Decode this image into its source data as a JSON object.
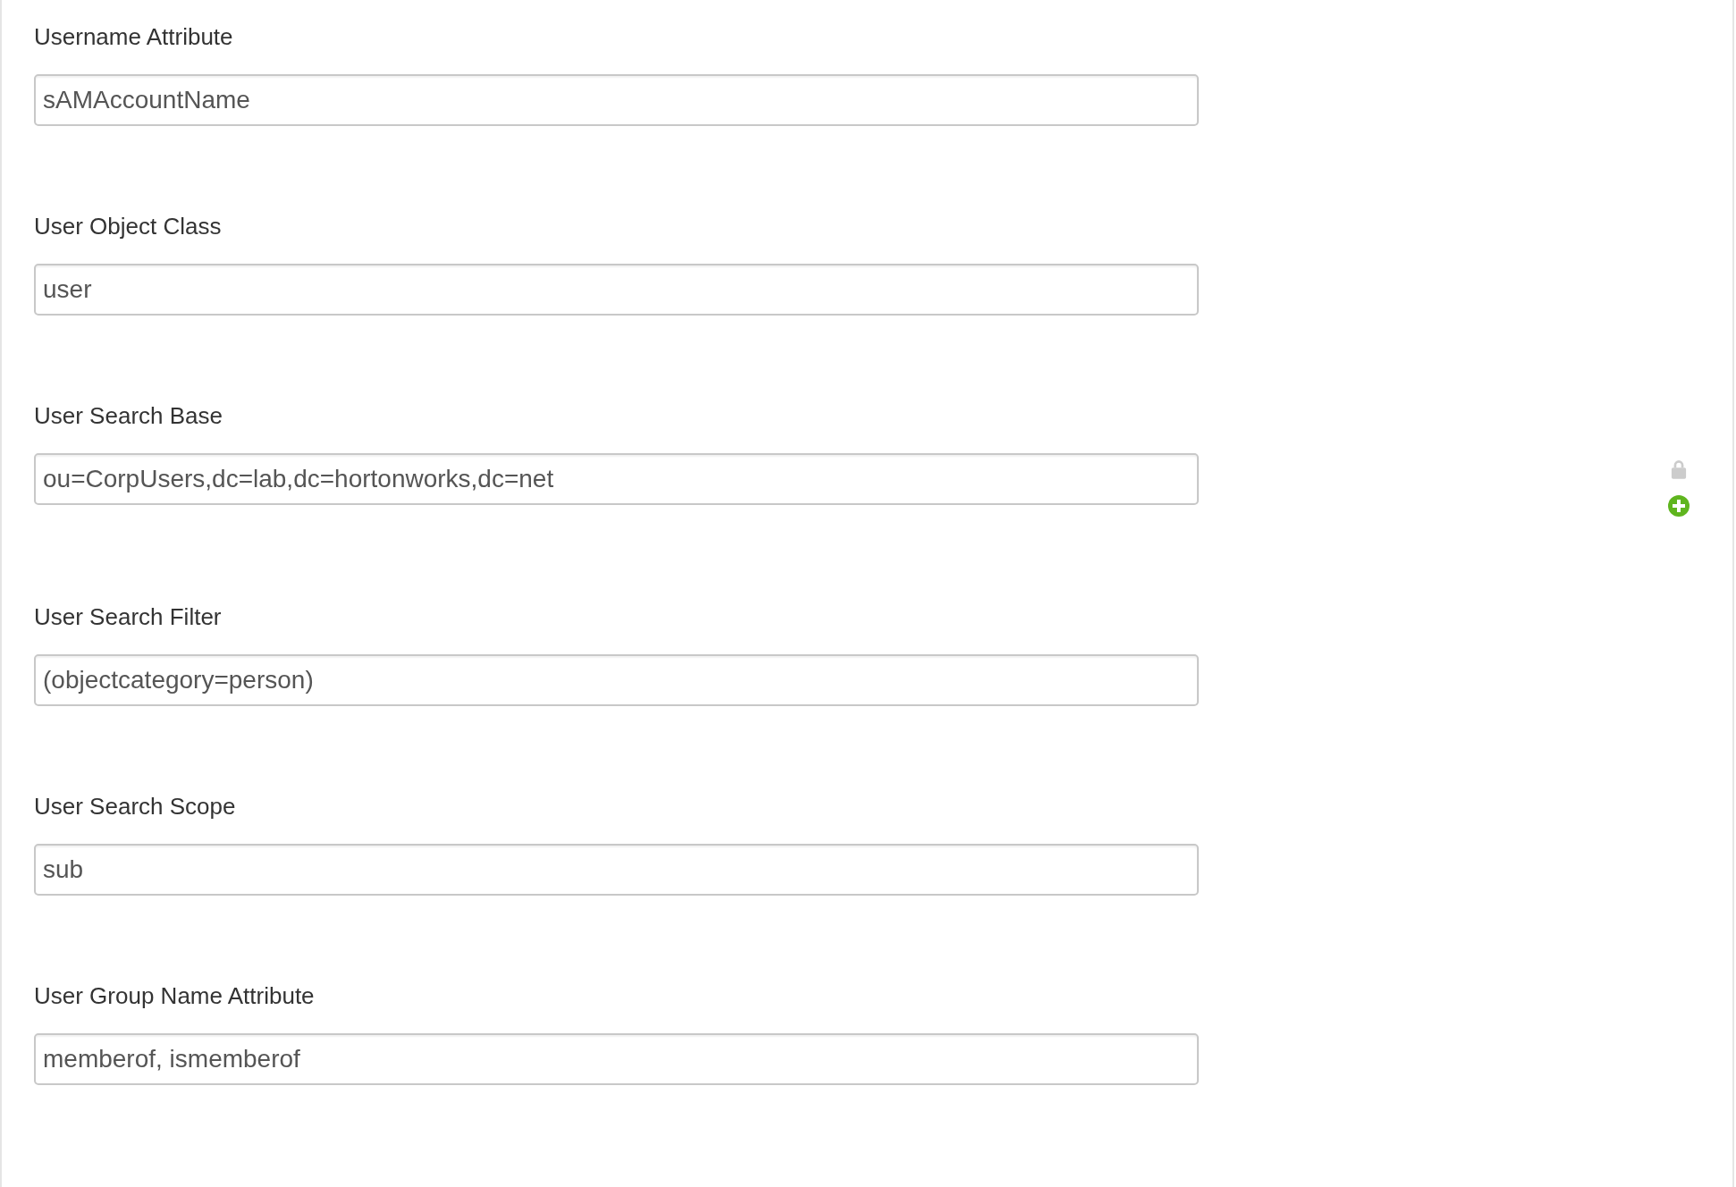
{
  "fields": [
    {
      "label": "Username Attribute",
      "value": "sAMAccountName",
      "hovered": false
    },
    {
      "label": "User Object Class",
      "value": "user",
      "hovered": false
    },
    {
      "label": "User Search Base",
      "value": "ou=CorpUsers,dc=lab,dc=hortonworks,dc=net",
      "hovered": true
    },
    {
      "label": "User Search Filter",
      "value": "(objectcategory=person)",
      "hovered": false
    },
    {
      "label": "User Search Scope",
      "value": "sub",
      "hovered": false
    },
    {
      "label": "User Group Name Attribute",
      "value": "memberof, ismemberof",
      "hovered": false
    }
  ]
}
